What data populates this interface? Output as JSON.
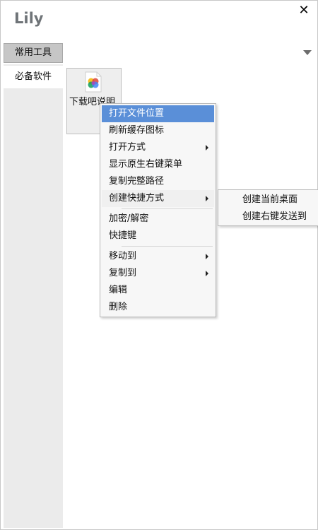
{
  "app": {
    "title": "Lily",
    "close_label": "✕"
  },
  "category": {
    "selected": "常用工具"
  },
  "sidebar": {
    "items": [
      {
        "label": "必备软件"
      }
    ]
  },
  "files": [
    {
      "name": "下载吧说明"
    }
  ],
  "context_menu": {
    "items": [
      {
        "label": "打开文件位置",
        "highlighted": true,
        "has_submenu": false
      },
      {
        "label": "刷新缓存图标",
        "highlighted": false,
        "has_submenu": false
      },
      {
        "label": "打开方式",
        "highlighted": false,
        "has_submenu": true
      },
      {
        "label": "显示原生右键菜单",
        "highlighted": false,
        "has_submenu": false
      },
      {
        "label": "复制完整路径",
        "highlighted": false,
        "has_submenu": false
      },
      {
        "label": "创建快捷方式",
        "highlighted": false,
        "has_submenu": true
      },
      {
        "label": "加密/解密",
        "highlighted": false,
        "has_submenu": false
      },
      {
        "label": "快捷键",
        "highlighted": false,
        "has_submenu": false
      },
      {
        "label": "移动到",
        "highlighted": false,
        "has_submenu": true
      },
      {
        "label": "复制到",
        "highlighted": false,
        "has_submenu": true
      },
      {
        "label": "编辑",
        "highlighted": false,
        "has_submenu": false
      },
      {
        "label": "删除",
        "highlighted": false,
        "has_submenu": false
      }
    ]
  },
  "submenu": {
    "items": [
      {
        "label": "创建当前桌面"
      },
      {
        "label": "创建右键发送到"
      }
    ]
  },
  "colors": {
    "highlight": "#5a8fd8",
    "title_gray": "#6f7478",
    "tab_gray": "#c6c6c6",
    "sidebar_bg": "#ebebeb"
  }
}
